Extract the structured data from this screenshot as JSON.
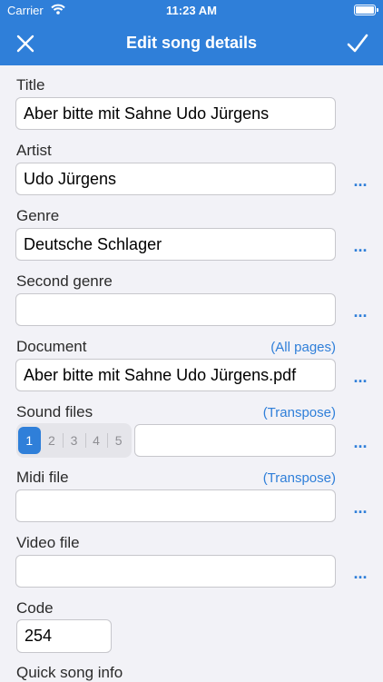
{
  "status_bar": {
    "carrier": "Carrier",
    "time": "11:23 AM"
  },
  "navbar": {
    "title": "Edit song details",
    "close_icon": "close-icon",
    "done_icon": "checkmark-icon"
  },
  "form": {
    "title": {
      "label": "Title",
      "value": "Aber bitte mit Sahne Udo Jürgens"
    },
    "artist": {
      "label": "Artist",
      "value": "Udo Jürgens",
      "more": "..."
    },
    "genre": {
      "label": "Genre",
      "value": "Deutsche Schlager",
      "more": "..."
    },
    "second_genre": {
      "label": "Second genre",
      "value": "",
      "more": "..."
    },
    "document": {
      "label": "Document",
      "link": "(All pages)",
      "value": "Aber bitte mit Sahne Udo Jürgens.pdf",
      "more": "..."
    },
    "sound_files": {
      "label": "Sound files",
      "link": "(Transpose)",
      "segments": [
        "1",
        "2",
        "3",
        "4",
        "5"
      ],
      "selected": "1",
      "value": "",
      "more": "..."
    },
    "midi_file": {
      "label": "Midi file",
      "link": "(Transpose)",
      "value": "",
      "more": "..."
    },
    "video_file": {
      "label": "Video file",
      "value": "",
      "more": "..."
    },
    "code": {
      "label": "Code",
      "value": "254"
    },
    "quick_song_info": {
      "label": "Quick song info"
    }
  },
  "colors": {
    "accent": "#2f7fd9",
    "background": "#f2f2f7"
  }
}
